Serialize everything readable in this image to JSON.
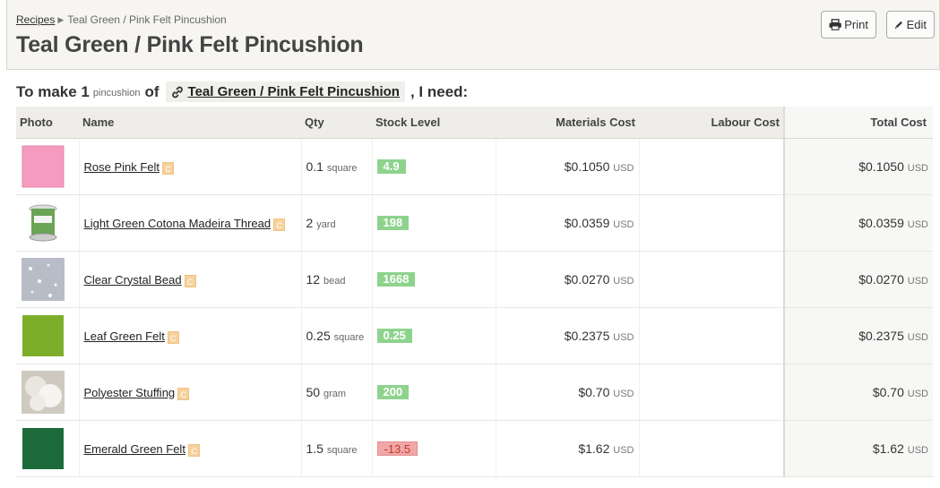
{
  "header": {
    "breadcrumb": {
      "root": "Recipes",
      "current": "Teal Green / Pink Felt Pincushion"
    },
    "title": "Teal Green / Pink Felt Pincushion",
    "print_label": "Print",
    "edit_label": "Edit"
  },
  "need_line": {
    "prefix": "To make 1",
    "unit": "pincushion",
    "of": "of",
    "product_link": "Teal Green / Pink Felt Pincushion",
    "suffix": ", I need:"
  },
  "table": {
    "columns": [
      "Photo",
      "Name",
      "Qty",
      "Stock Level",
      "Materials Cost",
      "Labour Cost",
      "Total Cost"
    ],
    "rows": [
      {
        "name": "Rose Pink Felt",
        "badge": "C",
        "qty": "0.1",
        "qty_unit": "square",
        "stock": "4.9",
        "stock_status": "ok",
        "materials_cost": "$0.1050",
        "labour_cost": "",
        "total_cost": "$0.1050",
        "currency": "USD",
        "photo_color": "#f59bc0",
        "photo_icon": "pink-felt-photo"
      },
      {
        "name": "Light Green Cotona Madeira Thread",
        "badge": "C",
        "qty": "2",
        "qty_unit": "yard",
        "stock": "198",
        "stock_status": "ok",
        "materials_cost": "$0.0359",
        "labour_cost": "",
        "total_cost": "$0.0359",
        "currency": "USD",
        "photo_color": "#6aa456",
        "photo_icon": "thread-spool-photo"
      },
      {
        "name": "Clear Crystal Bead",
        "badge": "C",
        "qty": "12",
        "qty_unit": "bead",
        "stock": "1668",
        "stock_status": "ok",
        "materials_cost": "$0.0270",
        "labour_cost": "",
        "total_cost": "$0.0270",
        "currency": "USD",
        "photo_color": "#b7bcc7",
        "photo_icon": "crystal-bead-photo"
      },
      {
        "name": "Leaf Green Felt",
        "badge": "C",
        "qty": "0.25",
        "qty_unit": "square",
        "stock": "0.25",
        "stock_status": "ok",
        "materials_cost": "$0.2375",
        "labour_cost": "",
        "total_cost": "$0.2375",
        "currency": "USD",
        "photo_color": "#7dae2a",
        "photo_icon": "green-felt-photo"
      },
      {
        "name": "Polyester Stuffing",
        "badge": "C",
        "qty": "50",
        "qty_unit": "gram",
        "stock": "200",
        "stock_status": "ok",
        "materials_cost": "$0.70",
        "labour_cost": "",
        "total_cost": "$0.70",
        "currency": "USD",
        "photo_color": "#e9e6df",
        "photo_icon": "stuffing-photo"
      },
      {
        "name": "Emerald Green Felt",
        "badge": "C",
        "qty": "1.5",
        "qty_unit": "square",
        "stock": "-13.5",
        "stock_status": "bad",
        "materials_cost": "$1.62",
        "labour_cost": "",
        "total_cost": "$1.62",
        "currency": "USD",
        "photo_color": "#1d6b3a",
        "photo_icon": "emerald-felt-photo"
      }
    ]
  }
}
